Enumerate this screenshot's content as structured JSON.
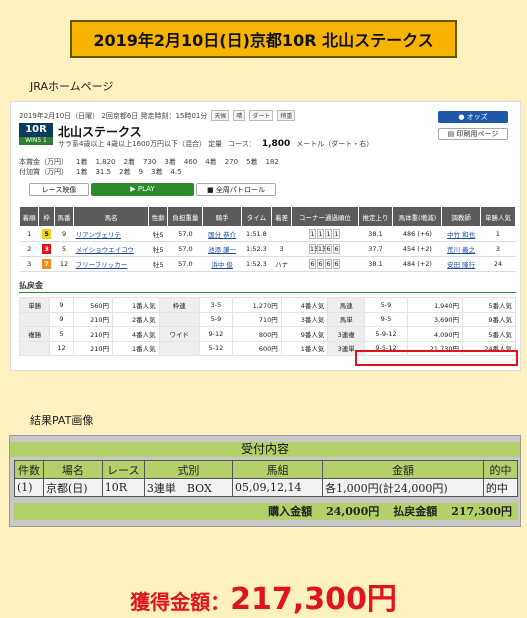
{
  "title": "2019年2月10日(日)京都10R 北山ステークス",
  "jra_label": "JRAホームページ",
  "pat_label": "結果PAT画像",
  "race": {
    "date": "2019年2月10日（日曜） 2回京都6日 発走時刻：15時01分",
    "tags": [
      "天候",
      "晴",
      "ダート",
      "稍重"
    ],
    "number": "10R",
    "grade": "WIN5 1",
    "name": "北山ステークス",
    "conditions": "サラ系4歳以上 4歳以上1600万円以下（混合） 定量",
    "course_label": "コース：",
    "course_value": "1,800",
    "course_unit": "メートル（ダート・右）",
    "prize_rows": [
      [
        "本賞金（万円）",
        "1着",
        "1,820",
        "2着",
        "730",
        "3着",
        "460",
        "4着",
        "270",
        "5着",
        "182"
      ],
      [
        "付加賞（万円）",
        "1着",
        "31.5",
        "2着",
        "9",
        "3着",
        "4.5"
      ]
    ],
    "buttons": {
      "odds": "オッズ",
      "print": "印刷用ページ",
      "replay": "レース映像",
      "play": "PLAY",
      "patrol": "全周パトロール"
    }
  },
  "results": {
    "headers": [
      "着順",
      "枠",
      "馬番",
      "馬名",
      "性齢",
      "負担重量",
      "騎手",
      "タイム",
      "着差",
      "コーナー通過順位",
      "推定上り",
      "馬体重(増減)",
      "調教師",
      "単勝人気"
    ],
    "rows": [
      {
        "pos": "1",
        "waku": "5",
        "waku_color": "#f5d215",
        "num": "9",
        "name": "リアンヴェリテ",
        "sex": "牡5",
        "weight": "57.0",
        "jockey": "国分 恭介",
        "time": "1:51.8",
        "margin": "",
        "corners": [
          "1",
          "1",
          "1",
          "1"
        ],
        "last": "38.1",
        "body": "486 (+6)",
        "trainer": "中竹 和也",
        "pop": "1"
      },
      {
        "pos": "2",
        "waku": "3",
        "waku_color": "#e0141e",
        "num": "5",
        "name": "メイショウエイコウ",
        "sex": "牡5",
        "weight": "57.0",
        "jockey": "池添 謙一",
        "time": "1:52.3",
        "margin": "3",
        "corners": [
          "13",
          "13",
          "6",
          "6"
        ],
        "last": "37.7",
        "body": "454 (+2)",
        "trainer": "荒川 義之",
        "pop": "3"
      },
      {
        "pos": "3",
        "waku": "7",
        "waku_color": "#f08c1c",
        "num": "12",
        "name": "フリーフリッカー",
        "sex": "牡5",
        "weight": "57.0",
        "jockey": "浜中 俊",
        "time": "1:52.3",
        "margin": "ハナ",
        "corners": [
          "6",
          "6",
          "6",
          "6"
        ],
        "last": "38.1",
        "body": "484 (+2)",
        "trainer": "安田 隆行",
        "pop": "24"
      }
    ]
  },
  "payout": {
    "title": "払戻金",
    "rows": [
      [
        "単勝",
        "9",
        "560円",
        "1番人気",
        "枠連",
        "3-5",
        "1,270円",
        "4番人気",
        "馬連",
        "5-9",
        "1,940円",
        "5番人気"
      ],
      [
        "",
        "9",
        "210円",
        "2番人気",
        "",
        "5-9",
        "710円",
        "3番人気",
        "馬単",
        "9-5",
        "3,690円",
        "9番人気"
      ],
      [
        "複勝",
        "5",
        "210円",
        "4番人気",
        "ワイド",
        "9-12",
        "800円",
        "9番人気",
        "3連複",
        "5-9-12",
        "4,090円",
        "5番人気"
      ],
      [
        "",
        "12",
        "210円",
        "1番人気",
        "",
        "5-12",
        "600円",
        "1番人気",
        "3連単",
        "9-5-12",
        "21,730円",
        "24番人気"
      ]
    ]
  },
  "pat": {
    "header": "受付内容",
    "columns": [
      "件数",
      "場名",
      "レース",
      "式別",
      "馬組",
      "金額",
      "的中"
    ],
    "row": [
      "(1)",
      "京都(日)",
      "10R",
      "3連単　BOX",
      "05,09,12,14",
      "各1,000円(計24,000円)",
      "的中"
    ],
    "purchase_label": "購入金額",
    "purchase_value": "24,000円",
    "refund_label": "払戻金額",
    "refund_value": "217,300円"
  },
  "winnings": {
    "label": "獲得金額：",
    "amount": "217,300円"
  }
}
